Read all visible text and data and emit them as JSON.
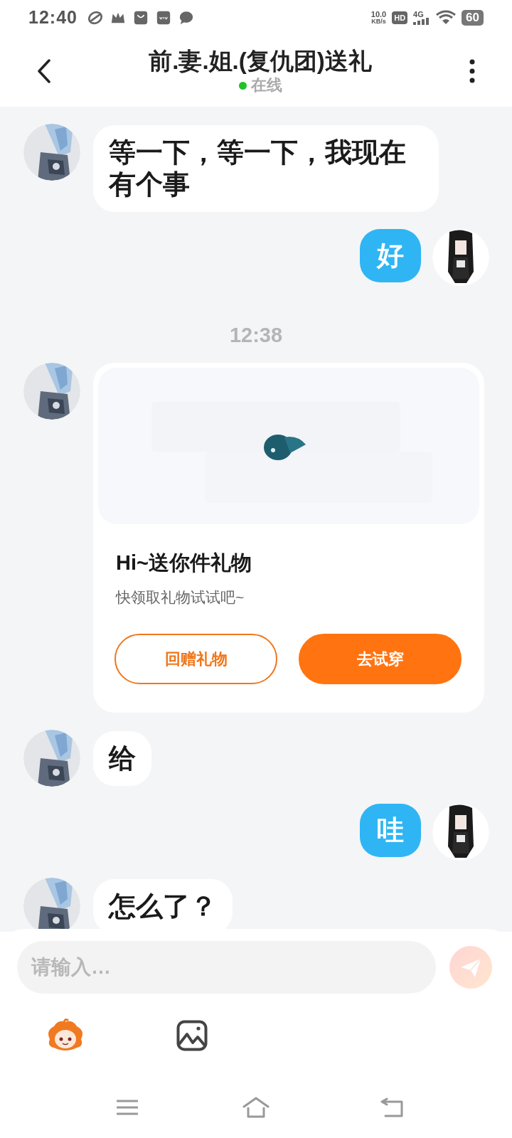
{
  "status_bar": {
    "time": "12:40",
    "speed_value": "10.0",
    "speed_unit": "KB/s",
    "hd": "HD",
    "network": "4G",
    "battery": "60"
  },
  "header": {
    "title": "前.妻.姐.(复仇团)送礼",
    "status": {
      "text": "在线",
      "online": true
    }
  },
  "messages": [
    {
      "kind": "incoming",
      "text": "等一下，等一下，我现在有个事"
    },
    {
      "kind": "outgoing",
      "text": "好"
    },
    {
      "kind": "time",
      "text": "12:38"
    },
    {
      "kind": "gift",
      "title": "Hi~送你件礼物",
      "subtitle": "快领取礼物试试吧~",
      "buttons": [
        {
          "label": "回赠礼物",
          "kind": "outline"
        },
        {
          "label": "去试穿",
          "kind": "filled"
        }
      ]
    },
    {
      "kind": "incoming",
      "text": "给"
    },
    {
      "kind": "outgoing",
      "text": "哇"
    },
    {
      "kind": "incoming",
      "text": "怎么了？"
    }
  ],
  "composer": {
    "placeholder": "请输入…",
    "send_disabled": true
  }
}
